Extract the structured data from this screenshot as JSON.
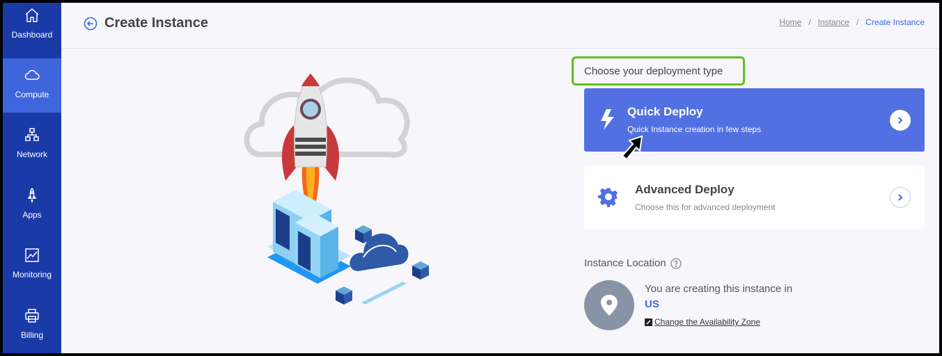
{
  "sidebar": {
    "items": [
      {
        "label": "Dashboard",
        "icon": "home-icon"
      },
      {
        "label": "Compute",
        "icon": "cloud-icon",
        "active": true
      },
      {
        "label": "Network",
        "icon": "network-icon"
      },
      {
        "label": "Apps",
        "icon": "rocket-icon"
      },
      {
        "label": "Monitoring",
        "icon": "chart-icon"
      },
      {
        "label": "Billing",
        "icon": "printer-icon"
      }
    ]
  },
  "header": {
    "title": "Create Instance",
    "breadcrumb": [
      "Home",
      "/",
      "Instance",
      "/",
      "Create Instance"
    ]
  },
  "deploy": {
    "prompt": "Choose your deployment type",
    "quick": {
      "title": "Quick Deploy",
      "subtitle": "Quick Instance creation in few steps"
    },
    "advanced": {
      "title": "Advanced Deploy",
      "subtitle": "Choose this for advanced deployment"
    }
  },
  "location": {
    "label": "Instance Location",
    "text": "You are creating this instance in",
    "region": "US",
    "change_link": "Change the Availability Zone"
  },
  "colors": {
    "sidebar": "#1a3aa8",
    "active": "#3f65dc",
    "quick_card": "#5270e2",
    "highlight": "#5fbf1c"
  }
}
